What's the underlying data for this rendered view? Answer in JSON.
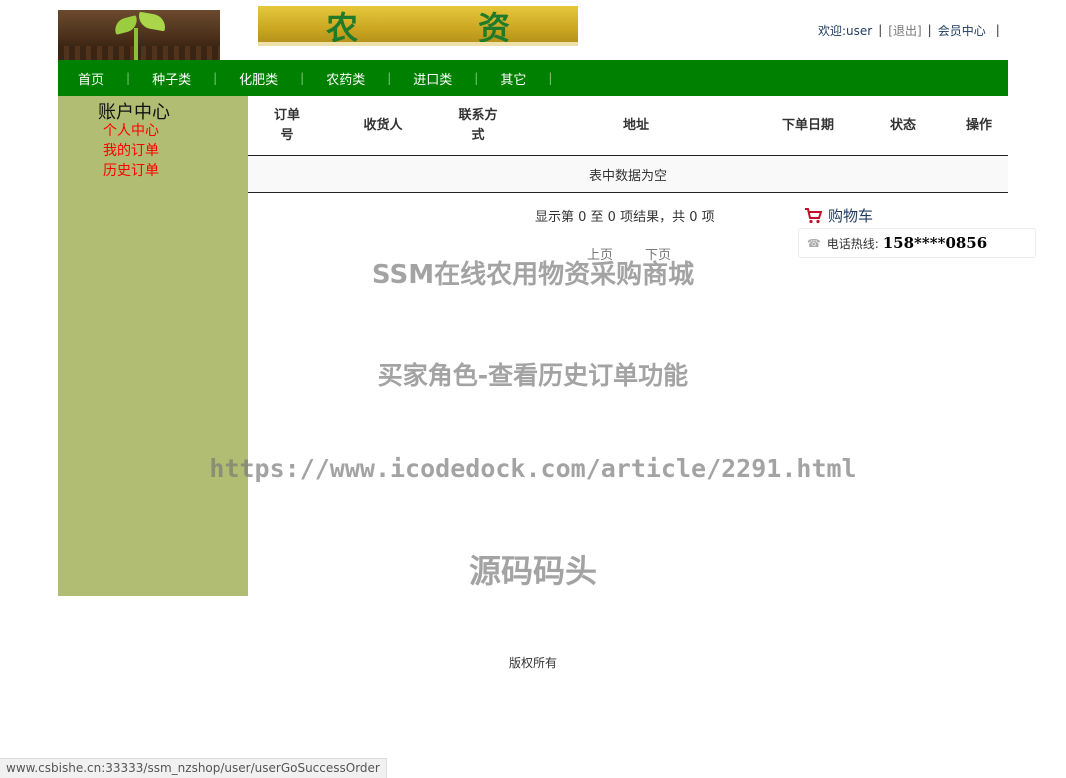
{
  "header": {
    "banner_text_left": "农",
    "banner_text_right": "资",
    "welcome": "欢迎:user",
    "logout": "[退出]",
    "member_center": "会员中心",
    "pipe": "|"
  },
  "nav": {
    "items": [
      {
        "label": "首页"
      },
      {
        "label": "种子类"
      },
      {
        "label": "化肥类"
      },
      {
        "label": "农药类"
      },
      {
        "label": "进口类"
      },
      {
        "label": "其它"
      }
    ],
    "separator": "|"
  },
  "sidebar": {
    "title": "账户中心",
    "links": [
      {
        "label": "个人中心"
      },
      {
        "label": "我的订单"
      },
      {
        "label": "历史订单"
      }
    ]
  },
  "table": {
    "columns": [
      "订单号",
      "收货人",
      "联系方式",
      "地址",
      "下单日期",
      "状态",
      "操作"
    ],
    "empty_text": "表中数据为空",
    "info": "显示第 0 至 0 项结果，共 0 项",
    "prev": "上页",
    "next": "下页"
  },
  "cart": {
    "label": "购物车",
    "hotline_label": "电话热线:",
    "hotline_number": "158****0856"
  },
  "watermark": {
    "line1": "SSM在线农用物资采购商城",
    "line2": "买家角色-查看历史订单功能",
    "line3": "https://www.icodedock.com/article/2291.html",
    "line4": "源码码头"
  },
  "footer": {
    "copyright": "版权所有"
  },
  "status_bar": {
    "url": "www.csbishe.cn:33333/ssm_nzshop/user/userGoSuccessOrder"
  },
  "colors": {
    "nav_green": "#008000",
    "sidebar_olive": "#b0bd72",
    "sidebar_link_red": "#ff0000"
  }
}
